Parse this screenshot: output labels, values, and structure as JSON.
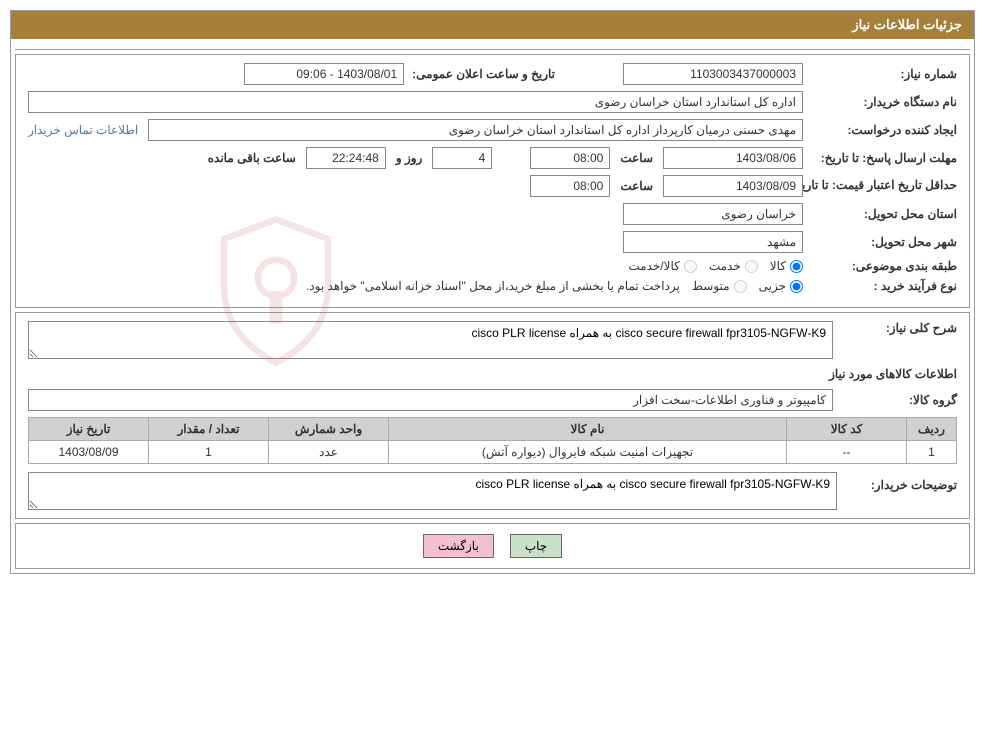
{
  "header": {
    "title": "جزئیات اطلاعات نیاز"
  },
  "section1": {
    "need_number_label": "شماره نیاز:",
    "need_number": "1103003437000003",
    "announce_date_label": "تاریخ و ساعت اعلان عمومی:",
    "announce_date": "1403/08/01 - 09:06",
    "buyer_org_label": "نام دستگاه خریدار:",
    "buyer_org": "اداره کل استاندارد استان خراسان رضوی",
    "requester_label": "ایجاد کننده درخواست:",
    "requester": "مهدی حسنی درمیان کارپرداز اداره کل استاندارد استان خراسان رضوی",
    "contact_link": "اطلاعات تماس خریدار",
    "reply_deadline_label": "مهلت ارسال پاسخ: تا تاریخ:",
    "reply_deadline_date": "1403/08/06",
    "hour_label": "ساعت",
    "reply_deadline_hour": "08:00",
    "days_word": "روز و",
    "days_remaining": "4",
    "countdown": "22:24:48",
    "countdown_suffix": "ساعت باقی مانده",
    "price_validity_label": "حداقل تاریخ اعتبار قیمت: تا تاریخ:",
    "price_validity_date": "1403/08/09",
    "price_validity_hour": "08:00",
    "delivery_province_label": "استان محل تحویل:",
    "delivery_province": "خراسان رضوی",
    "delivery_city_label": "شهر محل تحویل:",
    "delivery_city": "مشهد",
    "subject_class_label": "طبقه بندی موضوعی:",
    "subject_opt_kala": "کالا",
    "subject_opt_khadmat": "خدمت",
    "subject_opt_both": "کالا/خدمت",
    "purchase_type_label": "نوع فرآیند خرید :",
    "purchase_opt_partial": "جزیی",
    "purchase_opt_medium": "متوسط",
    "purchase_note": "پرداخت تمام یا بخشی از مبلغ خرید،از محل \"اسناد خزانه اسلامی\" خواهد بود."
  },
  "section2": {
    "general_desc_label": "شرح کلی نیاز:",
    "general_desc": "cisco secure firewall fpr3105-NGFW-K9 به همراه cisco PLR license",
    "items_heading": "اطلاعات کالاهای مورد نیاز",
    "group_label": "گروه کالا:",
    "group_value": "کامپیوتر و فناوری اطلاعات-سخت افزار",
    "table": {
      "headers": {
        "row": "ردیف",
        "code": "کد کالا",
        "name": "نام کالا",
        "unit": "واحد شمارش",
        "qty": "تعداد / مقدار",
        "date": "تاریخ نیاز"
      },
      "rows": [
        {
          "row": "1",
          "code": "--",
          "name": "تجهیزات امنیت شبکه فایروال (دیواره آتش)",
          "unit": "عدد",
          "qty": "1",
          "date": "1403/08/09"
        }
      ]
    },
    "buyer_notes_label": "توضیحات خریدار:",
    "buyer_notes": "cisco secure firewall fpr3105-NGFW-K9 به همراه cisco PLR license"
  },
  "buttons": {
    "print": "چاپ",
    "back": "بازگشت"
  }
}
